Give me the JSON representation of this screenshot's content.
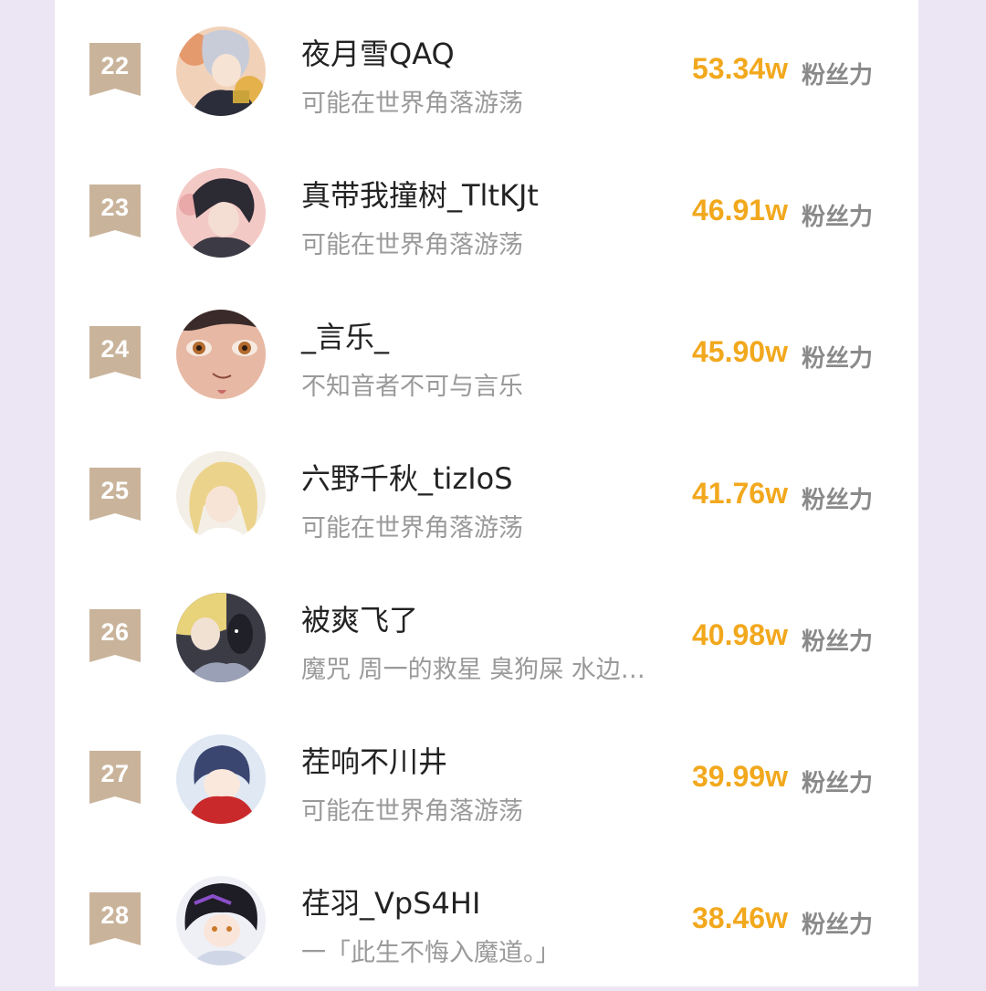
{
  "colors": {
    "background": "#ece6f4",
    "card": "#ffffff",
    "badge": "#c9b49b",
    "name_text": "#222222",
    "subtitle_text": "#9a9a9a",
    "score_text": "#f2a81d",
    "score_unit_text": "#8a8a8a"
  },
  "ranking": [
    {
      "rank": "22",
      "name": "夜月雪QAQ",
      "subtitle": "可能在世界角落游荡",
      "score": "53.34w",
      "unit": "粉丝力",
      "avatar_icon": "avatar-anime-silver-hair"
    },
    {
      "rank": "23",
      "name": "真带我撞树_TltKJt",
      "subtitle": "可能在世界角落游荡",
      "score": "46.91w",
      "unit": "粉丝力",
      "avatar_icon": "avatar-anime-dark-hair"
    },
    {
      "rank": "24",
      "name": "_言乐_",
      "subtitle": "不知音者不可与言乐",
      "score": "45.90w",
      "unit": "粉丝力",
      "avatar_icon": "avatar-anime-eyes-closeup"
    },
    {
      "rank": "25",
      "name": "六野千秋_tizIoS",
      "subtitle": "可能在世界角落游荡",
      "score": "41.76w",
      "unit": "粉丝力",
      "avatar_icon": "avatar-anime-blonde"
    },
    {
      "rank": "26",
      "name": "被爽飞了",
      "subtitle": "魔咒 周一的救星 臭狗屎 水边…",
      "score": "40.98w",
      "unit": "粉丝力",
      "avatar_icon": "avatar-anime-blonde-dark"
    },
    {
      "rank": "27",
      "name": "茬响不川井",
      "subtitle": "可能在世界角落游荡",
      "score": "39.99w",
      "unit": "粉丝力",
      "avatar_icon": "avatar-anime-chibi-red"
    },
    {
      "rank": "28",
      "name": "荏羽_VpS4HI",
      "subtitle": "一「此生不悔入魔道。」",
      "score": "38.46w",
      "unit": "粉丝力",
      "avatar_icon": "avatar-anime-chibi-dark"
    }
  ]
}
